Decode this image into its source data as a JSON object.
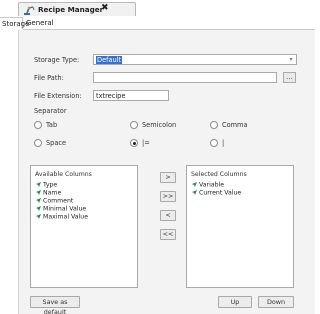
{
  "window": {
    "tab_title": "Recipe Manager",
    "close_glyph": "✖",
    "icon": "robot-arm-icon"
  },
  "subtabs": [
    {
      "label": "Storage",
      "active": true
    },
    {
      "label": "General",
      "active": false
    }
  ],
  "storage": {
    "storage_type_label": "Storage Type:",
    "storage_type_value": "Default",
    "file_path_label": "File Path:",
    "file_path_value": "",
    "browse_label": "...",
    "file_extension_label": "File Extension:",
    "file_extension_value": "txtrecipe"
  },
  "separator": {
    "label": "Separator",
    "options": [
      {
        "label": "Tab",
        "checked": false
      },
      {
        "label": "Semicolon",
        "checked": false
      },
      {
        "label": "Comma",
        "checked": false
      },
      {
        "label": "Space",
        "checked": false
      },
      {
        "label": "|=",
        "checked": true
      },
      {
        "label": "|",
        "checked": false
      }
    ]
  },
  "available_columns": {
    "header": "Available Columns",
    "items": [
      "Type",
      "Name",
      "Comment",
      "Minimal Value",
      "Maximal Value"
    ]
  },
  "selected_columns": {
    "header": "Selected Columns",
    "items": [
      "Variable",
      "Current Value"
    ]
  },
  "transfer_buttons": [
    ">",
    ">>",
    "<",
    "<<"
  ],
  "footer": {
    "save_default_label": "Save as default",
    "up_label": "Up",
    "down_label": "Down"
  },
  "colors": {
    "accent": "#3470d3",
    "item_icon": "#2e8b57"
  }
}
